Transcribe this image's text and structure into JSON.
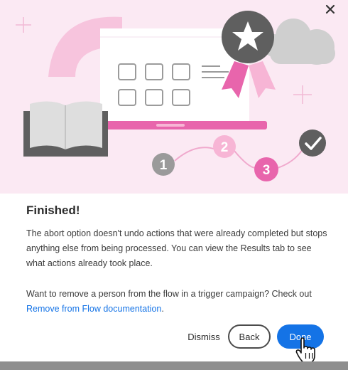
{
  "dialog": {
    "title": "Finished!",
    "paragraph1": "The abort option doesn't undo actions that were already completed but stops anything else from being processed. You can view the Results tab to see what actions already took place.",
    "paragraph2_text": "Want to remove a person from the flow in a trigger campaign? Check out ",
    "paragraph2_link": "Remove from Flow documentation",
    "paragraph2_end": "."
  },
  "buttons": {
    "dismiss": "Dismiss",
    "back": "Back",
    "done": "Done"
  },
  "illustration": {
    "steps": [
      "1",
      "2",
      "3"
    ]
  },
  "icons": {
    "close": "close-icon",
    "book": "book-icon",
    "award": "award-ribbon-icon",
    "check": "checkmark-icon",
    "cloud": "cloud-icon",
    "cursor": "hand-pointer-icon"
  },
  "colors": {
    "accent": "#1473e6",
    "hero_bg": "#fbe9f3",
    "pink": "#e865ac"
  }
}
